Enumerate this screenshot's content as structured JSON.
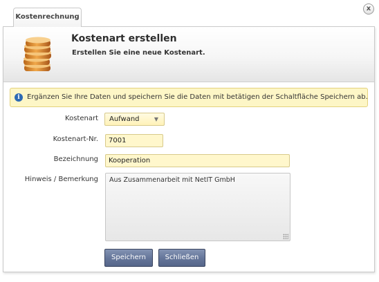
{
  "tab": {
    "label": "Kostenrechnung"
  },
  "window": {
    "close_label": "x"
  },
  "header": {
    "title": "Kostenart erstellen",
    "subtitle": "Erstellen Sie eine neue Kostenart."
  },
  "info": {
    "icon": "info-icon",
    "message": "Ergänzen Sie Ihre Daten und speichern Sie die Daten mit betätigen der Schaltfläche Speichern ab."
  },
  "form": {
    "kostenart_label": "Kostenart",
    "kostenart_value": "Aufwand",
    "nummer_label": "Kostenart-Nr.",
    "nummer_value": "7001",
    "bezeichnung_label": "Bezeichnung",
    "bezeichnung_value": "Kooperation",
    "hinweis_label": "Hinweis / Bemerkung",
    "hinweis_value": "Aus Zusammenarbeit mit NetIT GmbH"
  },
  "buttons": {
    "save_label": "Speichern",
    "close_label": "Schließen"
  },
  "colors": {
    "field_bg": "#fff7cc",
    "info_bg": "#fdf6c6",
    "button_bg": "#66779b"
  }
}
